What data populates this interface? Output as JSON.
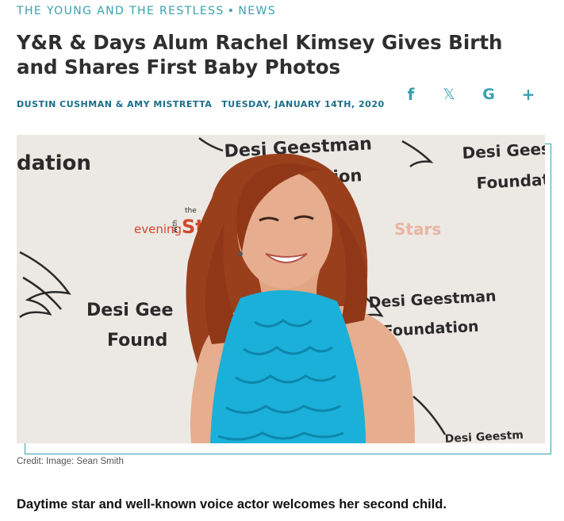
{
  "section": {
    "primary": "THE YOUNG AND THE RESTLESS",
    "separator": "•",
    "secondary": "NEWS"
  },
  "article": {
    "headline": "Y&R & Days Alum Rachel Kimsey Gives Birth and Shares First Baby Photos",
    "authors": "DUSTIN CUSHMAN & AMY MISTRETTA",
    "date": "TUESDAY, JANUARY 14TH, 2020",
    "credit": "Credit: Image: Sean Smith",
    "dek": "Daytime star and well-known voice actor welcomes her second child."
  },
  "share": {
    "facebook": "f",
    "x": "𝕏",
    "google": "G",
    "more": "+"
  },
  "hero": {
    "backdrop_texts": {
      "dation_left": "dation",
      "desi_geestman_top": "Desi Geestman",
      "desi_gees_right": "Desi Gees",
      "foundati_right": "Foundati",
      "dation_center": "dation",
      "evening": "evening",
      "with": "with",
      "the_small": "the",
      "stars_left": "St",
      "stars_right": "Stars",
      "desi_gee_lower": "Desi Gee",
      "found_lower": "Found",
      "desi_geestman_lower": "Desi Geestman",
      "foundation_lower": "Foundation",
      "desi_geestm_bottom": "Desi Geestm"
    },
    "colors": {
      "backdrop": "#ece9e4",
      "dress": "#1ab0d9",
      "hair": "#9a3f1c",
      "skin": "#e6ad8e",
      "accent": "#3aa0ae",
      "byline": "#1b6e8a"
    }
  }
}
